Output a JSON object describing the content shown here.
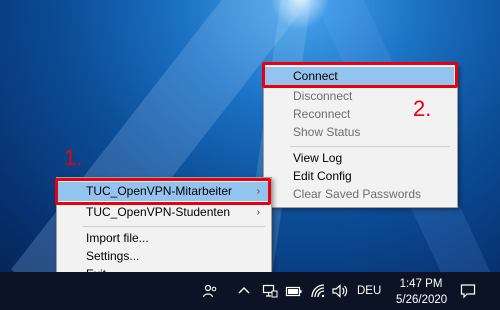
{
  "annotations": {
    "step_one": "1.",
    "step_two": "2."
  },
  "context_menu": {
    "items": [
      {
        "label": "Connect",
        "enabled": true,
        "highlighted": true
      },
      {
        "label": "Disconnect",
        "enabled": false
      },
      {
        "label": "Reconnect",
        "enabled": false
      },
      {
        "label": "Show Status",
        "enabled": false
      },
      {
        "label": "View Log",
        "enabled": true
      },
      {
        "label": "Edit Config",
        "enabled": true
      },
      {
        "label": "Clear Saved Passwords",
        "enabled": false
      }
    ]
  },
  "profile_menu": {
    "items": [
      {
        "label": "TUC_OpenVPN-Mitarbeiter",
        "has_submenu": true,
        "highlighted": true
      },
      {
        "label": "TUC_OpenVPN-Studenten",
        "has_submenu": true
      },
      {
        "label": "Import file..."
      },
      {
        "label": "Settings..."
      },
      {
        "label": "Exit"
      }
    ],
    "submenu_arrow": "›"
  },
  "taskbar": {
    "language": "DEU",
    "time": "1:47 PM",
    "date": "5/26/2020",
    "icons": [
      "people-icon",
      "chevron-up-icon",
      "network-icon",
      "battery-icon",
      "wifi-icon",
      "volume-icon",
      "notification-icon"
    ]
  },
  "colors": {
    "highlight": "#93c4ee",
    "annotation_red": "#e8000d",
    "taskbar": "#0c1324"
  }
}
